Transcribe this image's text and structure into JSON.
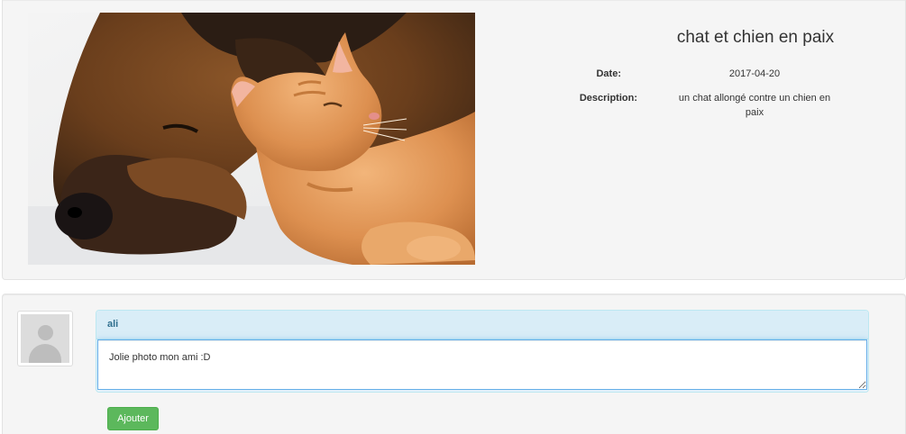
{
  "photo": {
    "title": "chat et chien en paix",
    "date_label": "Date:",
    "date_value": "2017-04-20",
    "description_label": "Description:",
    "description_value": "un chat allongé contre un chien en paix"
  },
  "comment": {
    "author": "ali",
    "text": "Jolie photo mon ami :D",
    "submit_label": "Ajouter"
  },
  "icons": {
    "avatar": "user-placeholder-icon"
  },
  "colors": {
    "panel_bg": "#f5f5f5",
    "comment_header_bg": "#d9edf7",
    "comment_header_text": "#31708f",
    "button_bg": "#5cb85c"
  }
}
